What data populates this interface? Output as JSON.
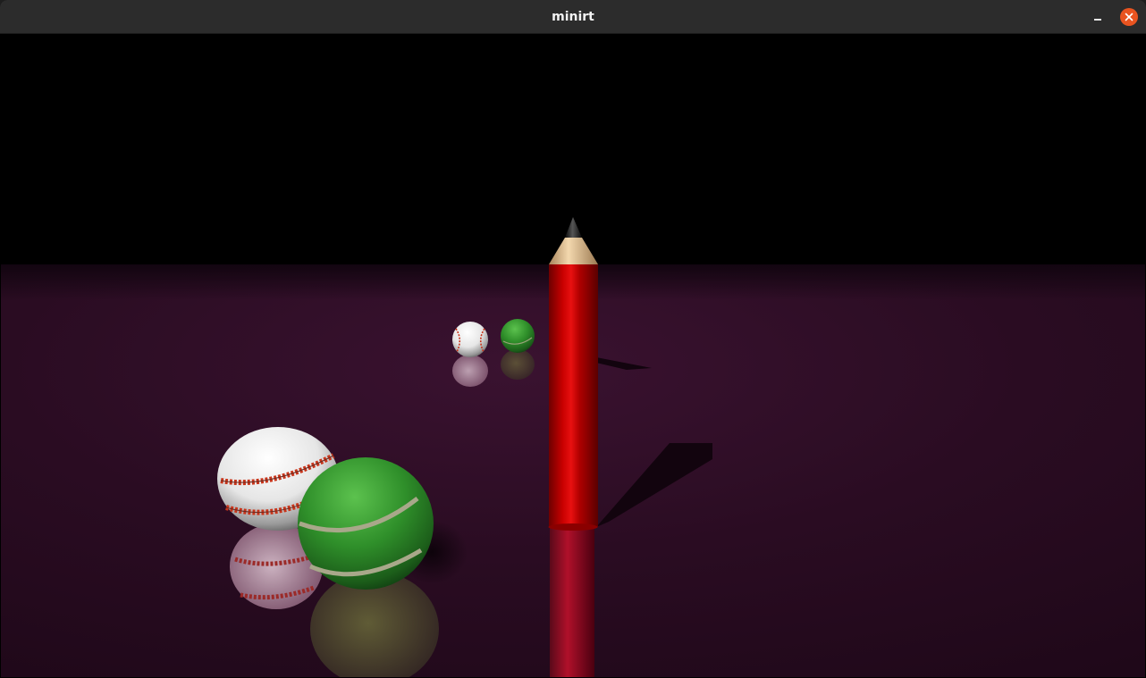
{
  "window": {
    "title": "minirt",
    "controls": {
      "minimize": "minimize-icon",
      "close": "close-icon"
    },
    "colors": {
      "titlebar": "#2c2c2c",
      "close_button": "#e95420"
    }
  },
  "scene": {
    "background": "#000000",
    "floor_color": "#2a0d22",
    "objects": [
      {
        "name": "pencil",
        "color": "#c40000",
        "tip_color": "#222222",
        "wood_color": "#e8c79a"
      },
      {
        "name": "baseball-near",
        "color": "#f0f0f0",
        "seam_color": "#c8341a"
      },
      {
        "name": "tennis-ball-near",
        "color": "#2e8c2a"
      },
      {
        "name": "baseball-far",
        "color": "#f0f0f0",
        "seam_color": "#c8341a"
      },
      {
        "name": "tennis-ball-far",
        "color": "#2e8c2a"
      }
    ]
  }
}
